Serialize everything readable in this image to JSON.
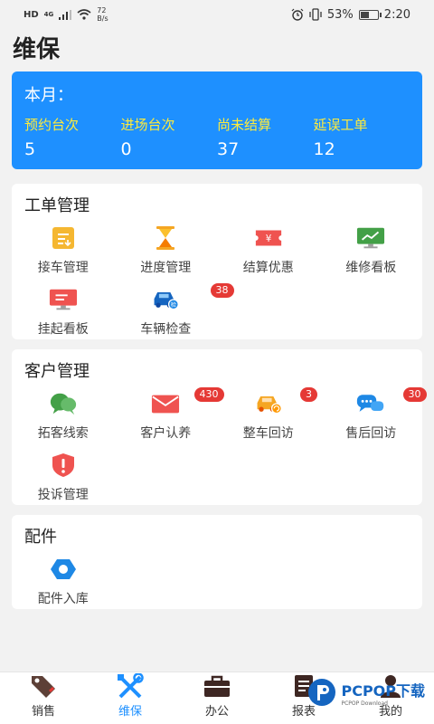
{
  "status_bar": {
    "network": "HD",
    "signal": "4G",
    "speed_value": "72",
    "speed_unit": "B/s",
    "battery_percent": "53%",
    "battery_level": 0.53,
    "time": "2:20"
  },
  "page": {
    "title": "维保"
  },
  "month_summary": {
    "title": "本月：",
    "stats": [
      {
        "label": "预约台次",
        "value": "5"
      },
      {
        "label": "进场台次",
        "value": "0"
      },
      {
        "label": "尚未结算",
        "value": "37"
      },
      {
        "label": "延误工单",
        "value": "12"
      }
    ]
  },
  "work_orders": {
    "title": "工单管理",
    "items": [
      {
        "label": "接车管理",
        "icon": "clipboard-icon",
        "badge": ""
      },
      {
        "label": "进度管理",
        "icon": "hourglass-icon",
        "badge": ""
      },
      {
        "label": "结算优惠",
        "icon": "yen-ticket-icon",
        "badge": ""
      },
      {
        "label": "维修看板",
        "icon": "monitor-chart-icon",
        "badge": ""
      },
      {
        "label": "挂起看板",
        "icon": "monitor-icon",
        "badge": ""
      },
      {
        "label": "车辆检查",
        "icon": "car-check-icon",
        "badge": "38"
      }
    ]
  },
  "customers": {
    "title": "客户管理",
    "items": [
      {
        "label": "拓客线索",
        "icon": "chat-bubbles-icon",
        "badge": ""
      },
      {
        "label": "客户认养",
        "icon": "envelope-icon",
        "badge": "430"
      },
      {
        "label": "整车回访",
        "icon": "car-return-icon",
        "badge": "3"
      },
      {
        "label": "售后回访",
        "icon": "chat-icon",
        "badge": "30"
      },
      {
        "label": "投诉管理",
        "icon": "alert-shield-icon",
        "badge": ""
      }
    ]
  },
  "parts": {
    "title": "配件",
    "items": [
      {
        "label": "配件入库",
        "icon": "hex-nut-icon",
        "badge": ""
      }
    ]
  },
  "tabbar": {
    "tabs": [
      {
        "label": "销售",
        "icon": "tag-icon"
      },
      {
        "label": "维保",
        "icon": "tools-icon"
      },
      {
        "label": "办公",
        "icon": "briefcase-icon"
      },
      {
        "label": "报表",
        "icon": "report-icon"
      },
      {
        "label": "我的",
        "icon": "person-icon"
      }
    ],
    "active": "维保"
  },
  "watermark": {
    "text": "PCPOP下载",
    "sub": "PCPOP Download"
  },
  "colors": {
    "accent": "#1e90ff",
    "stat_label": "#ffeb3b",
    "badge": "#e53935"
  }
}
